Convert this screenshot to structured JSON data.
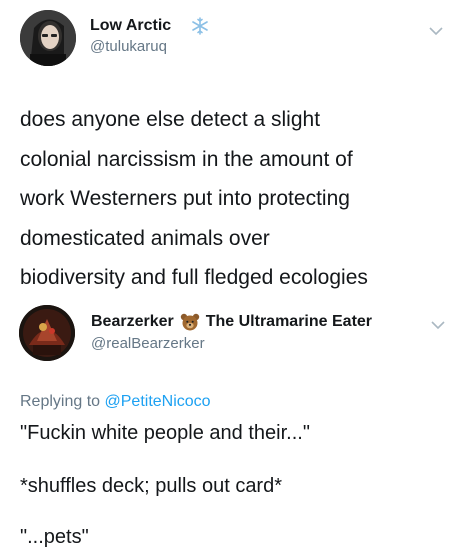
{
  "tweet1": {
    "display_name": "Low Arctic",
    "badge_icon": "snowflake-icon",
    "handle": "@tulukaruq",
    "text": "does anyone else detect a slight colonial narcissism in the amount of work Westerners put into protecting domesticated animals over biodiversity and full fledged ecologies",
    "lines": [
      "does anyone else detect a slight",
      "colonial narcissism in the amount of",
      "work Westerners put into protecting",
      "domesticated animals over",
      "biodiversity and full fledged ecologies"
    ]
  },
  "tweet2": {
    "display_name": "Bearzerker",
    "name_suffix": "The Ultramarine Eater",
    "badge_icon": "bear-emoji-icon",
    "handle": "@realBearzerker",
    "replying_prefix": "Replying to",
    "replying_to": "@PetiteNicoco",
    "lines": [
      "\"Fuckin white people and their...\"",
      "*shuffles deck; pulls out card*",
      "\"...pets\""
    ]
  },
  "colors": {
    "text": "#14171a",
    "secondary": "#657786",
    "link": "#1da1f2"
  }
}
